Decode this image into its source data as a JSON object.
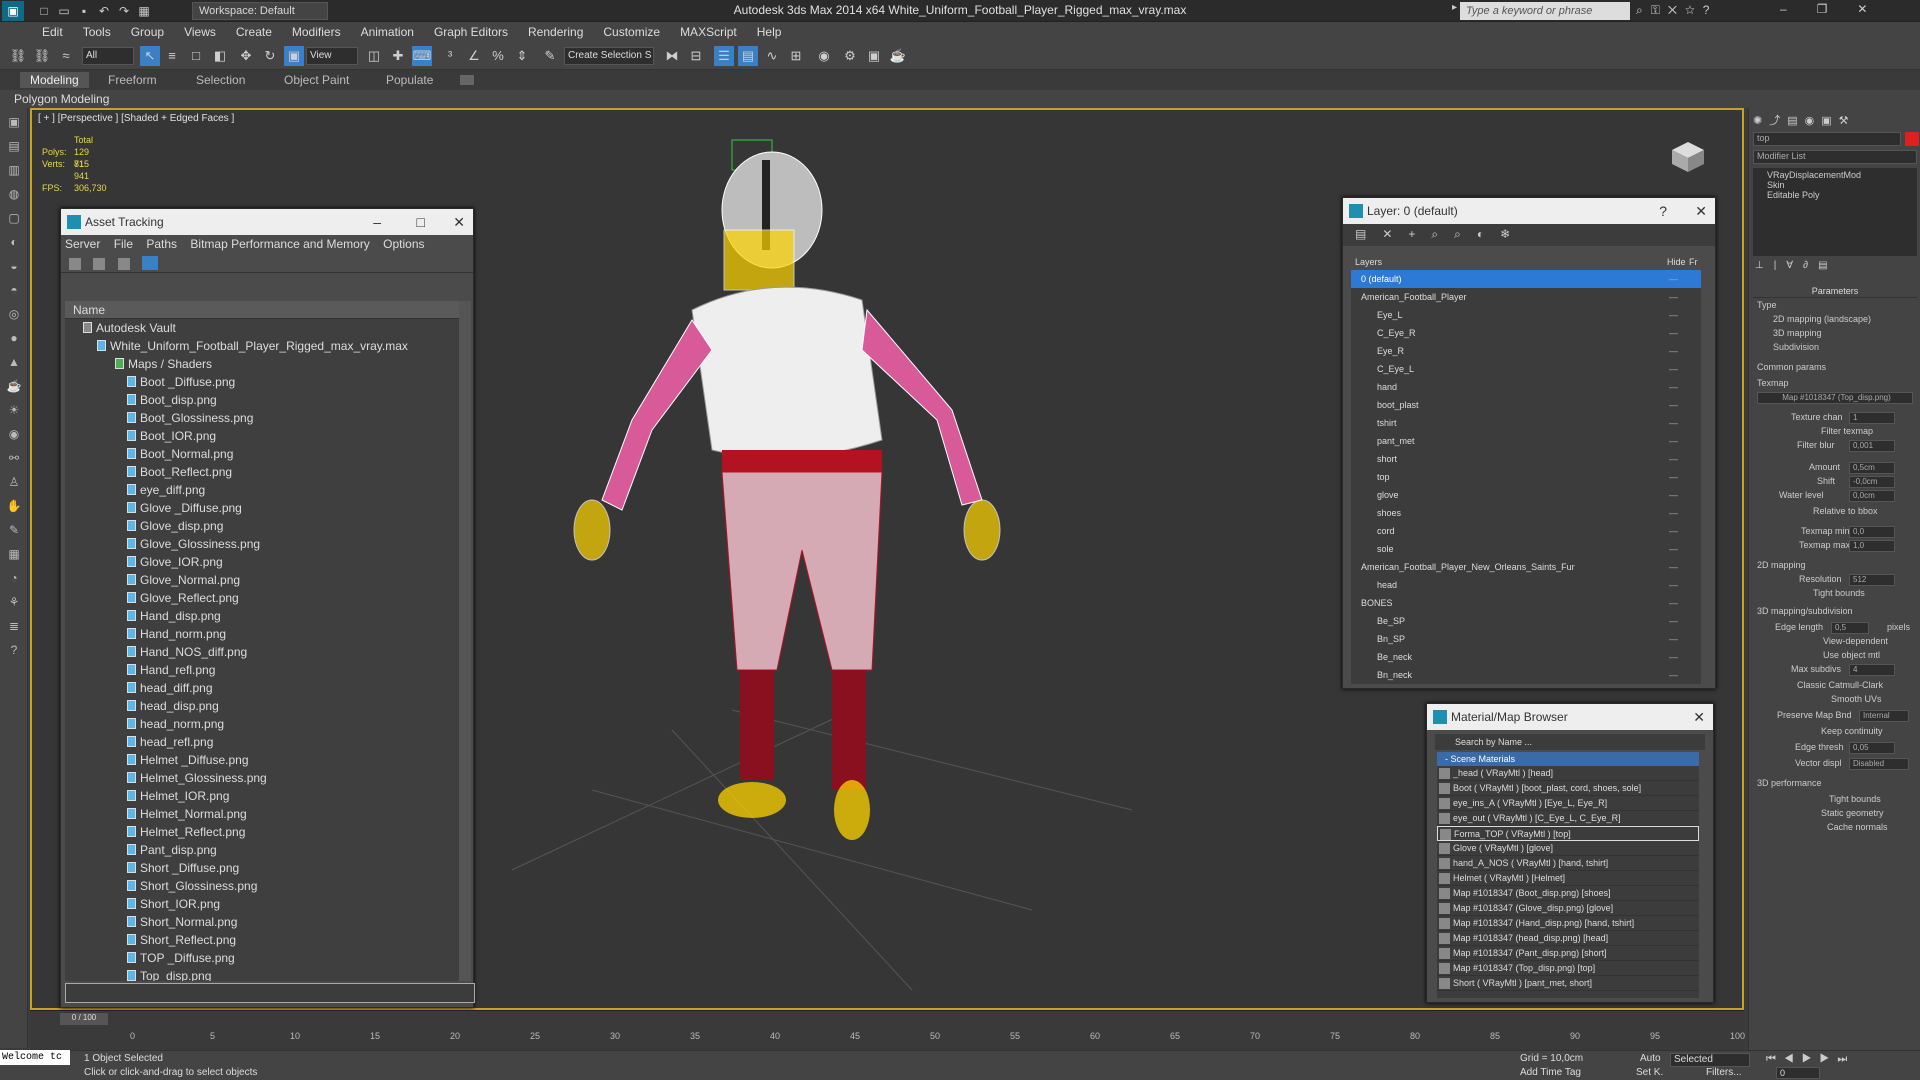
{
  "titlebar": {
    "title": "Autodesk 3ds Max  2014 x64     White_Uniform_Football_Player_Rigged_max_vray.max",
    "workspace": "Workspace: Default",
    "search_placeholder": "Type a keyword or phrase"
  },
  "menu": [
    "Edit",
    "Tools",
    "Group",
    "Views",
    "Create",
    "Modifiers",
    "Animation",
    "Graph Editors",
    "Rendering",
    "Customize",
    "MAXScript",
    "Help"
  ],
  "toolbar": {
    "filter": "All",
    "refcoord": "View",
    "selset": "Create Selection S"
  },
  "ribbon": {
    "tabs": [
      "Modeling",
      "Freeform",
      "Selection",
      "Object Paint",
      "Populate"
    ],
    "sub": "Polygon Modeling"
  },
  "viewport": {
    "label": "[ + ] [Perspective ] [Shaded + Edged Faces ]",
    "stats": {
      "total": "Total",
      "polys_label": "Polys:",
      "polys": "129 815",
      "verts_label": "Verts:",
      "verts": "71 941",
      "fps_label": "FPS:",
      "fps": "306,730"
    }
  },
  "asset_tracking": {
    "title": "Asset Tracking",
    "menu": [
      "Server",
      "File",
      "Paths",
      "Bitmap Performance and Memory",
      "Options"
    ],
    "column": "Name",
    "vault": "Autodesk Vault",
    "file": "White_Uniform_Football_Player_Rigged_max_vray.max",
    "folder": "Maps / Shaders",
    "maps": [
      "Boot _Diffuse.png",
      "Boot_disp.png",
      "Boot_Glossiness.png",
      "Boot_IOR.png",
      "Boot_Normal.png",
      "Boot_Reflect.png",
      "eye_diff.png",
      "Glove _Diffuse.png",
      "Glove_disp.png",
      "Glove_Glossiness.png",
      "Glove_IOR.png",
      "Glove_Normal.png",
      "Glove_Reflect.png",
      "Hand_disp.png",
      "Hand_norm.png",
      "Hand_NOS_diff.png",
      "Hand_refl.png",
      "head_diff.png",
      "head_disp.png",
      "head_norm.png",
      "head_refl.png",
      "Helmet _Diffuse.png",
      "Helmet_Glossiness.png",
      "Helmet_IOR.png",
      "Helmet_Normal.png",
      "Helmet_Reflect.png",
      "Pant_disp.png",
      "Short _Diffuse.png",
      "Short_Glossiness.png",
      "Short_IOR.png",
      "Short_Normal.png",
      "Short_Reflect.png",
      "TOP _Diffuse.png",
      "Top_disp.png"
    ]
  },
  "layer": {
    "title": "Layer: 0 (default)",
    "col_layers": "Layers",
    "col_hide": "Hide",
    "col_fr": "Fr",
    "rows": [
      {
        "name": "0 (default)",
        "level": 1,
        "sel": true
      },
      {
        "name": "American_Football_Player",
        "level": 1
      },
      {
        "name": "Eye_L",
        "level": 2
      },
      {
        "name": "C_Eye_R",
        "level": 2
      },
      {
        "name": "Eye_R",
        "level": 2
      },
      {
        "name": "C_Eye_L",
        "level": 2
      },
      {
        "name": "hand",
        "level": 2
      },
      {
        "name": "boot_plast",
        "level": 2
      },
      {
        "name": "tshirt",
        "level": 2
      },
      {
        "name": "pant_met",
        "level": 2
      },
      {
        "name": "short",
        "level": 2
      },
      {
        "name": "top",
        "level": 2
      },
      {
        "name": "glove",
        "level": 2
      },
      {
        "name": "shoes",
        "level": 2
      },
      {
        "name": "cord",
        "level": 2
      },
      {
        "name": "sole",
        "level": 2
      },
      {
        "name": "American_Football_Player_New_Orleans_Saints_Fur",
        "level": 1
      },
      {
        "name": "head",
        "level": 2
      },
      {
        "name": "BONES",
        "level": 1
      },
      {
        "name": "Be_SP",
        "level": 2
      },
      {
        "name": "Bn_SP",
        "level": 2
      },
      {
        "name": "Be_neck",
        "level": 2
      },
      {
        "name": "Bn_neck",
        "level": 2
      }
    ]
  },
  "material_browser": {
    "title": "Material/Map Browser",
    "search": "Search by Name ...",
    "section": "- Scene Materials",
    "rows": [
      "_head  ( VRayMtl ) [head]",
      "Boot  ( VRayMtl ) [boot_plast, cord, shoes, sole]",
      "eye_ins_A  ( VRayMtl ) [Eye_L, Eye_R]",
      "eye_out  ( VRayMtl ) [C_Eye_L, C_Eye_R]",
      "Forma_TOP  ( VRayMtl ) [top]",
      "Glove  ( VRayMtl ) [glove]",
      "hand_A_NOS  ( VRayMtl ) [hand, tshirt]",
      "Helmet  ( VRayMtl ) [Helmet]",
      "Map #1018347 (Boot_disp.png) [shoes]",
      "Map #1018347 (Glove_disp.png) [glove]",
      "Map #1018347 (Hand_disp.png) [hand, tshirt]",
      "Map #1018347 (head_disp.png) [head]",
      "Map #1018347 (Pant_disp.png) [short]",
      "Map #1018347 (Top_disp.png) [top]",
      "Short  ( VRayMtl ) [pant_met, short]"
    ]
  },
  "command_panel": {
    "name": "top",
    "modifier_list": "Modifier List",
    "stack": [
      "VRayDisplacementMod",
      "Skin",
      "Editable Poly"
    ],
    "parameters": "Parameters",
    "type": "Type",
    "types": [
      "2D mapping (landscape)",
      "3D mapping",
      "Subdivision"
    ],
    "common": "Common params",
    "texmap": "Texmap",
    "texmap_btn": "Map #1018347 (Top_disp.png)",
    "texture_chan": "Texture chan",
    "texture_chan_val": "1",
    "filter_texmap": "Filter texmap",
    "filter_blur": "Filter blur",
    "filter_blur_val": "0,001",
    "amount": "Amount",
    "amount_val": "0,5cm",
    "shift": "Shift",
    "shift_val": "-0,0cm",
    "water": "Water level",
    "water_val": "0,0cm",
    "relbox": "Relative to bbox",
    "texmin": "Texmap min",
    "texmin_val": "0,0",
    "texmax": "Texmap max",
    "texmax_val": "1,0",
    "s2d": "2D mapping",
    "resolution": "Resolution",
    "resolution_val": "512",
    "tight": "Tight bounds",
    "s3d": "3D mapping/subdivision",
    "edge_len": "Edge length",
    "edge_len_val": "0,5",
    "pixels": "pixels",
    "view_dep": "View-dependent",
    "use_obj": "Use object mtl",
    "max_subdivs": "Max subdivs",
    "max_subdivs_val": "4",
    "catmull": "Classic Catmull-Clark",
    "smooth_uvs": "Smooth UVs",
    "preserve": "Preserve Map Bnd",
    "preserve_val": "Internal",
    "keep_cont": "Keep continuity",
    "edge_thresh": "Edge thresh",
    "edge_thresh_val": "0,05",
    "vector_disp": "Vector displ",
    "vector_disp_val": "Disabled",
    "perf": "3D performance",
    "tight2": "Tight bounds",
    "static": "Static geometry",
    "cache": "Cache normals"
  },
  "timeline": {
    "frame": "0 / 100",
    "ticks": [
      "0",
      "5",
      "10",
      "15",
      "20",
      "25",
      "30",
      "35",
      "40",
      "45",
      "50",
      "55",
      "60",
      "65",
      "70",
      "75",
      "80",
      "85",
      "90",
      "95",
      "100"
    ]
  },
  "status": {
    "welcome": "Welcome tc",
    "selected": "1 Object Selected",
    "prompt": "Click or click-and-drag to select objects",
    "grid": "Grid = 10,0cm",
    "add_time_tag": "Add Time Tag",
    "auto": "Auto",
    "mode": "Selected",
    "setk": "Set K.",
    "filters": "Filters...",
    "frame_field": "0"
  }
}
